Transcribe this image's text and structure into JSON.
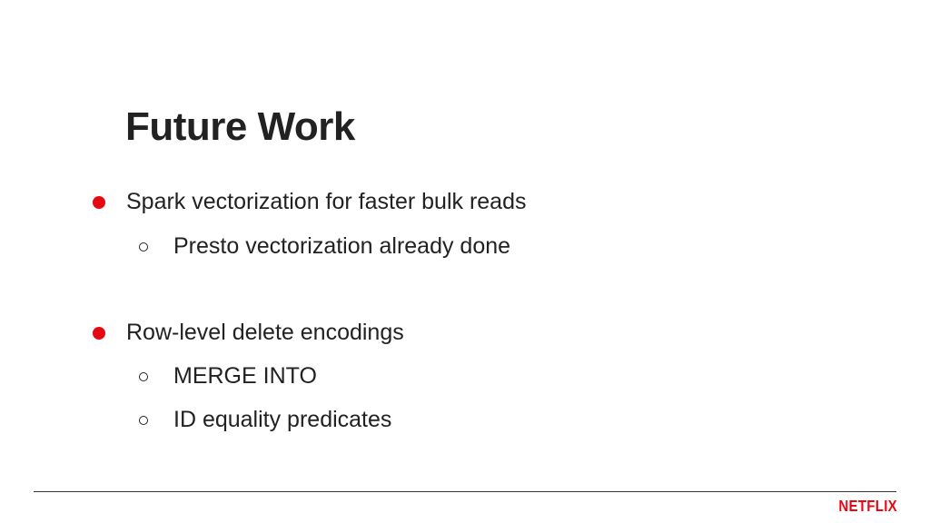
{
  "slide": {
    "title": "Future Work",
    "bullets": [
      {
        "text": "Spark vectorization for faster bulk reads",
        "sub": [
          "Presto vectorization already done"
        ]
      },
      {
        "text": "Row-level delete encodings",
        "sub": [
          "MERGE INTO",
          "ID equality predicates"
        ]
      }
    ]
  },
  "footer": {
    "brand": "NETFLIX"
  },
  "colors": {
    "accent": "#e50914",
    "text": "#222222",
    "background": "#ffffff"
  },
  "icons": {
    "primary_bullet": "filled-circle-icon",
    "secondary_bullet": "hollow-circle-icon"
  }
}
